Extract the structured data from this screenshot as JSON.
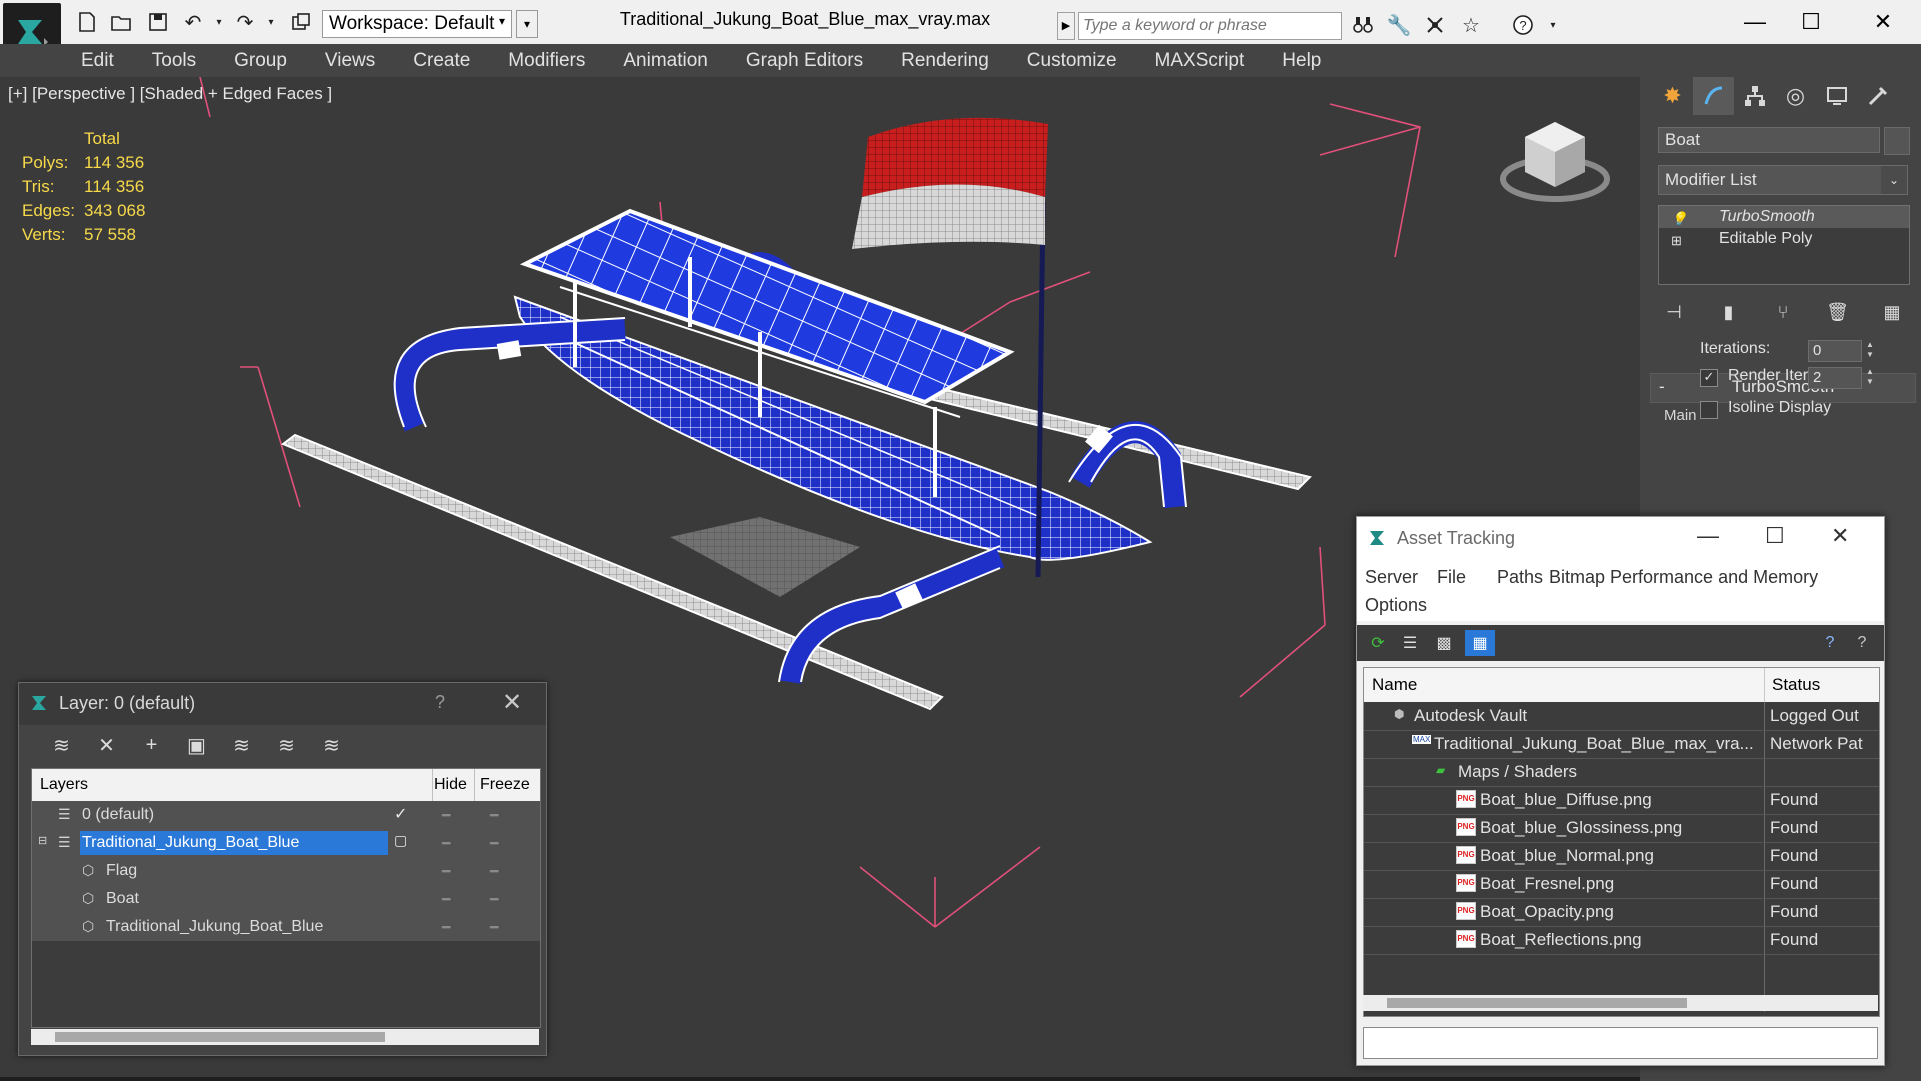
{
  "title_bar": {
    "workspace_label": "Workspace: Default",
    "document_title": "Traditional_Jukung_Boat_Blue_max_vray.max",
    "search_placeholder": "Type a keyword or phrase",
    "quick_access_icons": [
      "new-file-icon",
      "open-file-icon",
      "save-icon",
      "undo-icon",
      "redo-icon",
      "project-icon"
    ],
    "window_controls": [
      "minimize",
      "maximize",
      "close"
    ]
  },
  "menu": {
    "items": [
      "Edit",
      "Tools",
      "Group",
      "Views",
      "Create",
      "Modifiers",
      "Animation",
      "Graph Editors",
      "Rendering",
      "Customize",
      "MAXScript",
      "Help"
    ]
  },
  "viewport": {
    "label": "[+] [Perspective ] [Shaded + Edged Faces ]",
    "stats_header": "Total",
    "stats": [
      {
        "label": "Polys:",
        "value": "114 356"
      },
      {
        "label": "Tris:",
        "value": "114 356"
      },
      {
        "label": "Edges:",
        "value": "343 068"
      },
      {
        "label": "Verts:",
        "value": "57 558"
      }
    ],
    "colors": {
      "wire": "#ffffff",
      "hull": "#1e30c8",
      "flag_red": "#c81e1e",
      "bbox": "#e0507a",
      "background": "#3a3a3a"
    }
  },
  "command_panel": {
    "object_name": "Boat",
    "modifier_list": "Modifier List",
    "stack": [
      "TurboSmooth",
      "Editable Poly"
    ],
    "rollout_title": "TurboSmooth",
    "group_main": "Main",
    "iterations_label": "Iterations:",
    "iterations_value": "0",
    "render_iters_label": "Render Iters:",
    "render_iters_value": "2",
    "isoline_label": "Isoline Display"
  },
  "layer_dialog": {
    "title": "Layer: 0 (default)",
    "help": "?",
    "columns": {
      "layers": "Layers",
      "hide": "Hide",
      "freeze": "Freeze"
    },
    "rows": [
      {
        "name": "0 (default)",
        "level": 0
      },
      {
        "name": "Traditional_Jukung_Boat_Blue",
        "level": 0
      },
      {
        "name": "Flag",
        "level": 1
      },
      {
        "name": "Boat",
        "level": 1
      },
      {
        "name": "Traditional_Jukung_Boat_Blue",
        "level": 1
      }
    ]
  },
  "asset_tracking": {
    "title": "Asset Tracking",
    "menu": [
      "Server",
      "File",
      "Paths",
      "Bitmap Performance and Memory",
      "Options"
    ],
    "columns": {
      "name": "Name",
      "status": "Status"
    },
    "rows": [
      {
        "name": "Autodesk Vault",
        "status": "Logged Out"
      },
      {
        "name": "Traditional_Jukung_Boat_Blue_max_vra...",
        "status": "Network Pat"
      },
      {
        "name": "Maps / Shaders",
        "status": ""
      },
      {
        "name": "Boat_blue_Diffuse.png",
        "status": "Found"
      },
      {
        "name": "Boat_blue_Glossiness.png",
        "status": "Found"
      },
      {
        "name": "Boat_blue_Normal.png",
        "status": "Found"
      },
      {
        "name": "Boat_Fresnel.png",
        "status": "Found"
      },
      {
        "name": "Boat_Opacity.png",
        "status": "Found"
      },
      {
        "name": "Boat_Reflections.png",
        "status": "Found"
      }
    ]
  }
}
